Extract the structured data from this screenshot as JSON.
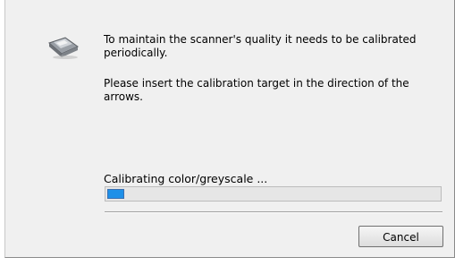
{
  "dialog": {
    "icon": "scanner-icon",
    "message_line1": "To maintain the scanner's quality it needs to be calibrated periodically.",
    "message_line2": "Please insert the calibration target in the direction of the arrows.",
    "status_label": "Calibrating color/greyscale ...",
    "progress_fraction": 0.05,
    "cancel_label": "Cancel",
    "accent_color": "#1e90e8"
  }
}
